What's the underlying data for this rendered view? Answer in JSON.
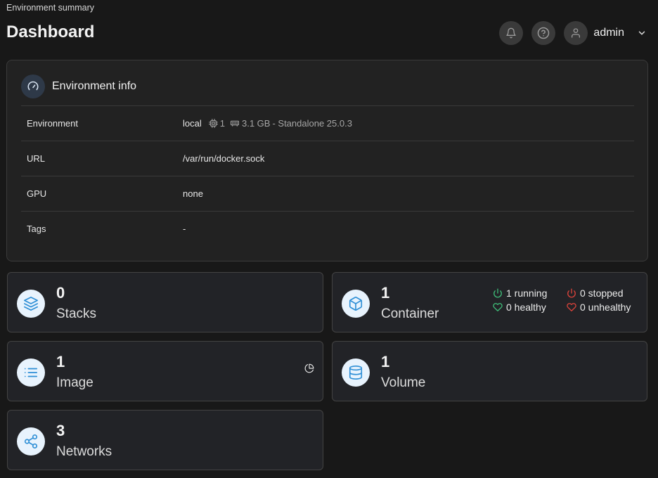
{
  "header": {
    "breadcrumb": "Environment summary",
    "title": "Dashboard",
    "user": "admin"
  },
  "env_info": {
    "title": "Environment info",
    "rows": [
      {
        "key": "Environment",
        "value": "local",
        "cpu": "1",
        "memory": "3.1 GB",
        "type": "- Standalone 25.0.3"
      },
      {
        "key": "URL",
        "value": "/var/run/docker.sock"
      },
      {
        "key": "GPU",
        "value": "none"
      },
      {
        "key": "Tags",
        "value": "-"
      }
    ]
  },
  "stats": {
    "stacks": {
      "value": "0",
      "label": "Stacks",
      "icon": "layers-icon"
    },
    "containers": {
      "value": "1",
      "label": "Container",
      "icon": "box-icon",
      "running": "1 running",
      "stopped": "0 stopped",
      "healthy": "0 healthy",
      "unhealthy": "0 unhealthy"
    },
    "images": {
      "value": "1",
      "label": "Image",
      "icon": "list-icon"
    },
    "volumes": {
      "value": "1",
      "label": "Volume",
      "icon": "database-icon"
    },
    "networks": {
      "value": "3",
      "label": "Networks",
      "icon": "share-icon"
    }
  },
  "colors": {
    "accent_icon": "#2e8fd6",
    "icon_bg": "#e8f3fd",
    "running": "#3fbf7a",
    "stopped": "#e0443b"
  }
}
